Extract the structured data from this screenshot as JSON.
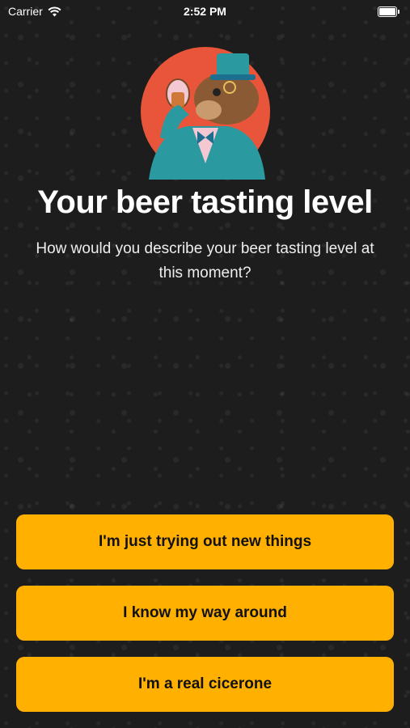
{
  "status_bar": {
    "carrier": "Carrier",
    "time": "2:52 PM",
    "wifi_icon": "wifi-icon",
    "battery_icon": "battery-icon"
  },
  "header": {
    "mascot": "bear-mascot-drinking-beer",
    "title": "Your beer tasting level",
    "subtitle": "How would you describe your beer tasting level at this moment?"
  },
  "options": [
    {
      "label": "I'm just trying out new things"
    },
    {
      "label": "I know my way around"
    },
    {
      "label": "I'm a real cicerone"
    }
  ],
  "colors": {
    "accent": "#FFB000",
    "background": "#1d1d1d",
    "mascot_circle": "#E8553A",
    "mascot_suit": "#2A9AA0"
  }
}
